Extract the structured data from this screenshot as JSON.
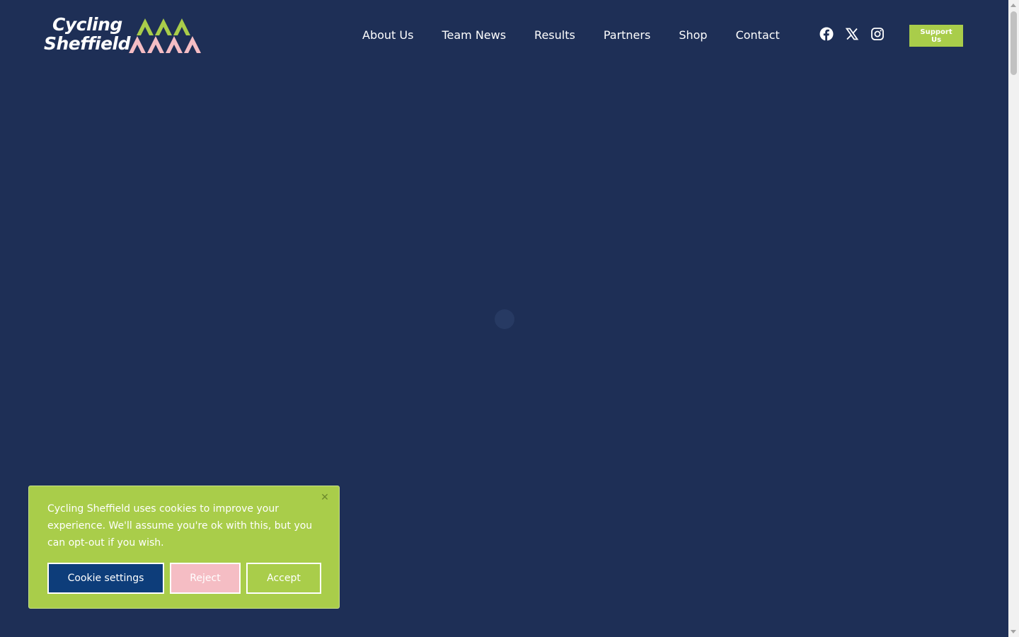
{
  "logo": {
    "line1": "Cycling",
    "line2": "Sheffield"
  },
  "nav": {
    "items": [
      {
        "label": "About Us"
      },
      {
        "label": "Team News"
      },
      {
        "label": "Results"
      },
      {
        "label": "Partners"
      },
      {
        "label": "Shop"
      },
      {
        "label": "Contact"
      }
    ]
  },
  "social": {
    "icons": [
      "facebook-icon",
      "x-twitter-icon",
      "instagram-icon"
    ]
  },
  "header": {
    "support_label": "Support Us"
  },
  "cookie_banner": {
    "text": "Cycling Sheffield uses cookies to improve your experience. We'll assume you're ok with this, but you can opt-out if you wish.",
    "close_symbol": "✕",
    "settings_label": "Cookie settings",
    "reject_label": "Reject",
    "accept_label": "Accept"
  },
  "colors": {
    "background": "#1e2f56",
    "accent_green": "#a9cd4a",
    "accent_pink": "#f5bdc4",
    "settings_blue": "#0d3d7a"
  }
}
